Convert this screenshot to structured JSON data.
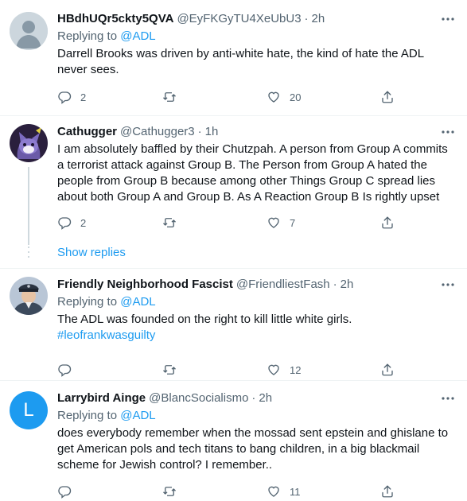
{
  "tweets": [
    {
      "name": "HBdhUQr5ckty5QVA",
      "handle": "@EyFKGyTU4XeUbU3",
      "dot": "·",
      "time": "2h",
      "replying_prefix": "Replying to",
      "replying_to": "@ADL",
      "text": "Darrell Brooks was driven by anti-white hate, the kind of hate the ADL never sees.",
      "replies": "2",
      "retweets": "",
      "likes": "20",
      "avatar_icon": "default-avatar-icon"
    },
    {
      "name": "Cathugger",
      "handle": "@Cathugger3",
      "dot": "·",
      "time": "1h",
      "text": "I am absolutely baffled by their Chutzpah. A person from Group A commits a terrorist attack against Group B. The Person from Group A hated the people from Group B because among other Things Group C spread lies about both Group A and Group B. As A Reaction Group B Is rightly upset",
      "replies": "2",
      "retweets": "",
      "likes": "7",
      "avatar_icon": "cat-avatar-icon"
    },
    {
      "name": "Friendly Neighborhood Fascist",
      "handle": "@FriendliestFash",
      "dot": "·",
      "time": "2h",
      "replying_prefix": "Replying to",
      "replying_to": "@ADL",
      "text": "The ADL was founded on the right to kill little white girls.",
      "hashtag": "#leofrankwasguilty",
      "replies": "",
      "retweets": "",
      "likes": "12",
      "avatar_icon": "officer-avatar-icon"
    },
    {
      "name": "Larrybird Ainge",
      "handle": "@BlancSocialismo",
      "dot": "·",
      "time": "2h",
      "replying_prefix": "Replying to",
      "replying_to": "@ADL",
      "text": "does everybody remember when the mossad sent epstein and ghislane to get American pols and tech titans to bang children, in a big blackmail scheme for Jewish control? I remember..",
      "replies": "",
      "retweets": "",
      "likes": "11",
      "avatar_letter": "L",
      "avatar_color": "#1d9bf0"
    }
  ],
  "show_replies_label": "Show replies",
  "colors": {
    "accent": "#1d9bf0",
    "secondary_text": "#536471",
    "separator": "#eff3f4"
  }
}
